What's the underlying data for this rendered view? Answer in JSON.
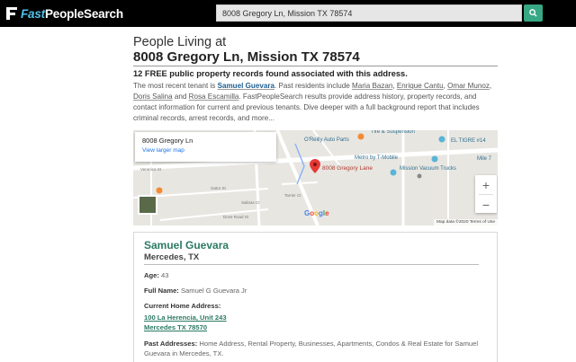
{
  "header": {
    "logo_prefix": "Fast",
    "logo_suffix": "PeopleSearch",
    "search_value": "8008 Gregory Ln, Mission TX 78574"
  },
  "page": {
    "intro": "People Living at",
    "address_title": "8008 Gregory Ln, Mission TX 78574",
    "records_count": "12 FREE public property records found associated with this address.",
    "desc_1": "The most recent tenant is ",
    "tenant": "Samuel Guevara",
    "desc_2": ". Past residents include ",
    "resident_1": "Maria Bazan",
    "resident_2": "Enrique Cantu",
    "resident_3": "Omar Munoz",
    "resident_4": "Doris Salina",
    "resident_5": "Rosa Escamilla",
    "desc_3": ". FastPeopleSearch results provide address history, property records, and contact information for current and previous tenants. Dive deeper with a full background report that includes criminal records, arrest records, and more..."
  },
  "map": {
    "card_address": "8008 Gregory Ln",
    "view_larger": "View larger map",
    "pin_label": "8008 Gregory Lane",
    "places": [
      "O'Reilly Auto Parts",
      "Metro by T-Mobile",
      "Mission Vacuum Trucks",
      "EL TIGRE #14",
      "Tire & Suspension",
      "Mile 7"
    ],
    "streets": [
      "Veronica St",
      "Gator St",
      "Tarrier Ct",
      "Dove Road St",
      "Salinas Ct"
    ],
    "google": "Google",
    "footer": "Map data ©2020   Terms of Use",
    "zoom_in": "+",
    "zoom_out": "−"
  },
  "person": {
    "name": "Samuel Guevara",
    "location": "Mercedes, TX",
    "age_label": "Age:",
    "age": "43",
    "fullname_label": "Full Name:",
    "fullname": "Samuel G Guevara Jr",
    "home_label": "Current Home Address:",
    "home_line1": "100 La Herencia, Unit 243",
    "home_line2": "Mercedes TX 78570",
    "past_label": "Past Addresses:",
    "past_text": "Home Address, Rental Property, Businesses, Apartments, Condos & Real Estate for Samuel Guevara in Mercedes, TX."
  },
  "icons": {
    "search": "search-icon",
    "pin": "map-pin-icon",
    "logo": "logo-icon"
  },
  "colors": {
    "accent": "#2b7a63",
    "search_button": "#37a883",
    "pin": "#e53935"
  }
}
